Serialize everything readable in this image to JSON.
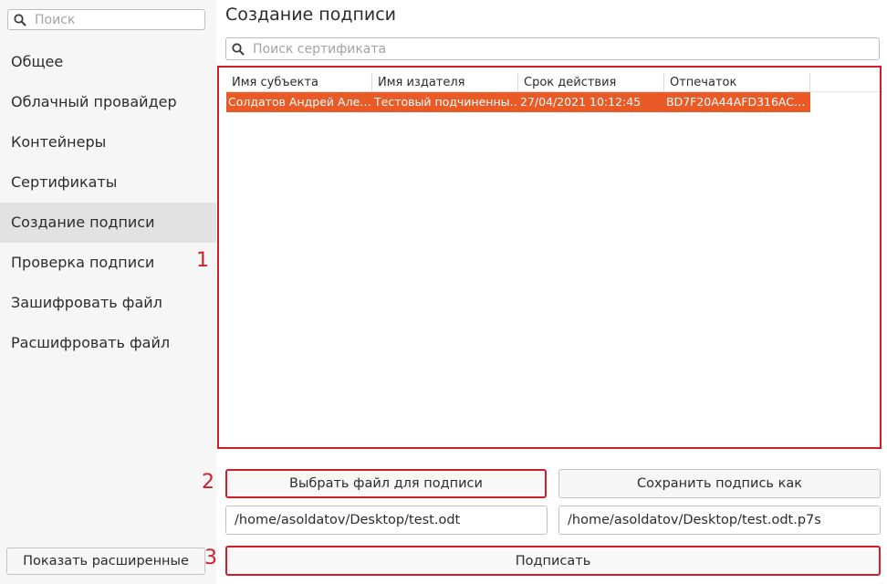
{
  "sidebar": {
    "search_placeholder": "Поиск",
    "items": [
      {
        "label": "Общее"
      },
      {
        "label": "Облачный провайдер"
      },
      {
        "label": "Контейнеры"
      },
      {
        "label": "Сертификаты"
      },
      {
        "label": "Создание подписи",
        "active": true
      },
      {
        "label": "Проверка подписи"
      },
      {
        "label": "Зашифровать файл"
      },
      {
        "label": "Расшифровать файл"
      }
    ],
    "advanced_button": "Показать расширенные"
  },
  "main": {
    "title": "Создание подписи",
    "cert_search_placeholder": "Поиск сертификата",
    "table": {
      "columns": [
        "Имя субъекта",
        "Имя издателя",
        "Срок действия",
        "Отпечаток"
      ],
      "rows": [
        {
          "subject": "Солдатов Андрей Але…",
          "issuer": "Тестовый подчиненны…",
          "validity": "27/04/2021 10:12:45",
          "thumbprint": "BD7F20A44AFD316AC…",
          "selected": true
        }
      ]
    },
    "choose_file_button": "Выбрать файл для подписи",
    "save_as_button": "Сохранить подпись как",
    "input_path": "/home/asoldatov/Desktop/test.odt",
    "output_path": "/home/asoldatov/Desktop/test.odt.p7s",
    "sign_button": "Подписать"
  },
  "markers": [
    "1",
    "2",
    "3"
  ],
  "colors": {
    "accent_selection": "#ea5a26",
    "highlight_border": "#d11f2a",
    "sidebar_bg": "#f6f6f6",
    "sidebar_active_bg": "#e2e2e2"
  },
  "icons": {
    "search": "search-icon"
  }
}
